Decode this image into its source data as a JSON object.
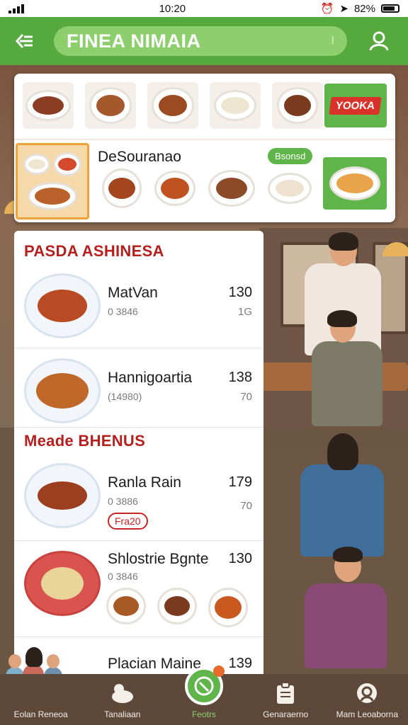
{
  "status_bar": {
    "time": "10:20",
    "battery": "82%"
  },
  "header": {
    "title": "FINEA NIMAIA",
    "title_mark": "I"
  },
  "categories": {
    "promo_tag": "YOOKA",
    "section_title": "DeSouranao",
    "badge": "Bsonsd"
  },
  "menu": {
    "groups": [
      {
        "title": "PASDA ASHINESA",
        "items": [
          {
            "name": "MatVan",
            "code": "0 3846",
            "price": "130",
            "sub": "1G"
          },
          {
            "name": "Hannigoartia",
            "code": "(14980)",
            "price": "138",
            "sub": "70"
          }
        ]
      },
      {
        "title": "Meade BHENUS",
        "items": [
          {
            "name": "Ranla Rain",
            "code": "0 3886",
            "price": "179",
            "sub": "70",
            "chip": "Fra20"
          },
          {
            "name": "Shlostrie Bgnte",
            "code": "0 3846",
            "price": "130"
          },
          {
            "name": "Placian Maine",
            "price": "139"
          }
        ]
      }
    ]
  },
  "nav": {
    "items": [
      {
        "label": "Eolan Reneoa"
      },
      {
        "label": "Tanaliaan"
      },
      {
        "label": "Feotrs"
      },
      {
        "label": "Genaraerno"
      },
      {
        "label": "Mam Leoaborna"
      }
    ]
  },
  "colors": {
    "accent": "#55a93d",
    "title_red": "#b5201f",
    "nav_bg": "#5e4839"
  }
}
